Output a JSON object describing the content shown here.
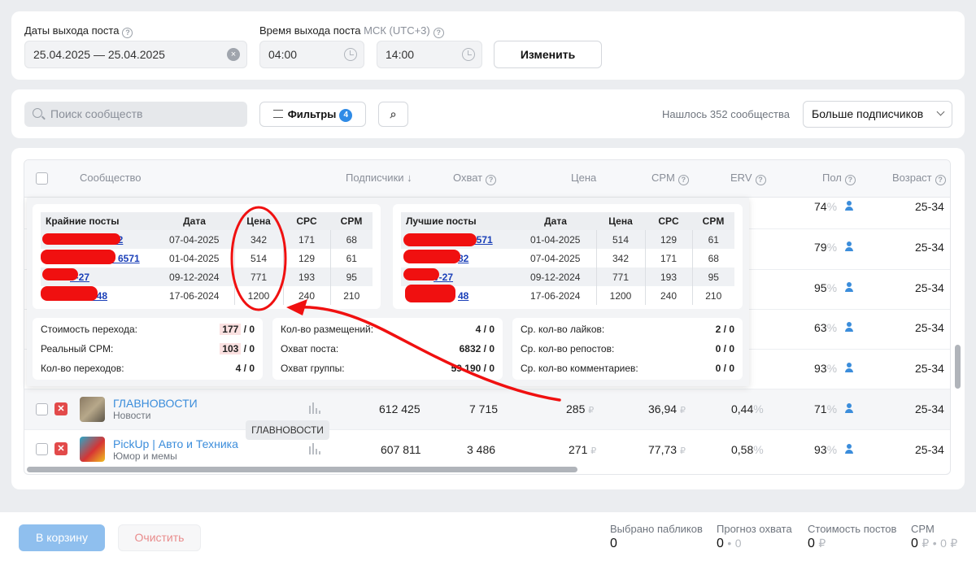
{
  "dates": {
    "label": "Даты выхода поста",
    "value": "25.04.2025 — 25.04.2025",
    "clear_icon": "clear-icon"
  },
  "time": {
    "label": "Время выхода поста",
    "tz": "МСК (UTC+3)",
    "from": "04:00",
    "to": "14:00",
    "apply_label": "Изменить"
  },
  "toolbar": {
    "search_placeholder": "Поиск сообществ",
    "filters_label": "Фильтры",
    "filters_count": "4",
    "found_text": "Нашлось 352 сообщества",
    "sort_value": "Больше подписчиков"
  },
  "table": {
    "headers": [
      "Сообщество",
      "Подписчики",
      "Охват",
      "Цена",
      "CPM",
      "ERV",
      "Пол",
      "Возраст"
    ],
    "sort_arrow": "↓",
    "bg_rows": [
      {
        "gender": "74",
        "age": "25-34"
      },
      {
        "gender": "79",
        "age": "25-34"
      },
      {
        "gender": "95",
        "age": "25-34"
      },
      {
        "gender": "63",
        "age": "25-34"
      },
      {
        "gender": "93",
        "age": "25-34"
      }
    ],
    "rows": [
      {
        "name": "ГЛАВНОВОСТИ",
        "category": "Новости",
        "subscribers": "612 425",
        "reach": "7 715",
        "price": "285",
        "cpm": "36,94",
        "erv": "0,44",
        "gender": "71",
        "age": "25-34"
      },
      {
        "name": "PickUp | Авто и Техника",
        "category": "Юмор и мемы",
        "subscribers": "607 811",
        "reach": "3 486",
        "price": "271",
        "cpm": "77,73",
        "erv": "0,58",
        "gender": "93",
        "age": "25-34"
      }
    ],
    "tooltip": "ГЛАВНОВОСТИ",
    "pct_sign": "%",
    "rub_sign": "₽"
  },
  "popup": {
    "recent": {
      "headers": [
        "Крайние посты",
        "Дата",
        "Цена",
        "CPC",
        "CPM"
      ],
      "rows": [
        {
          "link": "82",
          "date": "07-04-2025",
          "price": "342",
          "cpc": "171",
          "cpm": "68"
        },
        {
          "link": "b_6571",
          "date": "01-04-2025",
          "price": "514",
          "cpc": "129",
          "cpm": "61"
        },
        {
          "link": "v-27",
          "date": "09-12-2024",
          "price": "771",
          "cpc": "193",
          "cpm": "95"
        },
        {
          "link": "548",
          "date": "17-06-2024",
          "price": "1200",
          "cpc": "240",
          "cpm": "210"
        }
      ]
    },
    "best": {
      "headers": [
        "Лучшие посты",
        "Дата",
        "Цена",
        "CPC",
        "CPM"
      ],
      "rows": [
        {
          "link": "6571",
          "date": "01-04-2025",
          "price": "514",
          "cpc": "129",
          "cpm": "61"
        },
        {
          "link": "82",
          "date": "07-04-2025",
          "price": "342",
          "cpc": "171",
          "cpm": "68"
        },
        {
          "link": "v-27",
          "date": "09-12-2024",
          "price": "771",
          "cpc": "193",
          "cpm": "95"
        },
        {
          "link": "48",
          "date": "17-06-2024",
          "price": "1200",
          "cpc": "240",
          "cpm": "210"
        }
      ]
    },
    "stats1": [
      {
        "label": "Стоимость перехода:",
        "a": "177",
        "b": " / 0"
      },
      {
        "label": "Реальный CPM:",
        "a": "103",
        "b": " / 0"
      },
      {
        "label": "Кол-во переходов:",
        "a": "4",
        "b": " / 0"
      }
    ],
    "stats2": [
      {
        "label": "Кол-во размещений:",
        "v": "4 / 0"
      },
      {
        "label": "Охват поста:",
        "v": "6832 / 0"
      },
      {
        "label": "Охват группы:",
        "v": "59 190 / 0"
      }
    ],
    "stats3": [
      {
        "label": "Ср. кол-во лайков:",
        "v": "2 / 0"
      },
      {
        "label": "Ср. кол-во репостов:",
        "v": "0 / 0"
      },
      {
        "label": "Ср. кол-во комментариев:",
        "v": "0 / 0"
      }
    ]
  },
  "footer": {
    "cart_label": "В корзину",
    "clear_label": "Очистить",
    "selected_label": "Выбрано пабликов",
    "selected_value": "0",
    "reach_label": "Прогноз охвата",
    "reach_value": "0",
    "cost_label": "Стоимость постов",
    "cost_value": "0",
    "cpm_label": "CPM",
    "cpm_value": "0",
    "sep": "•",
    "zero": "0"
  },
  "colors": {
    "accent": "#2f8be6",
    "link": "#3b8ddb",
    "annotation": "#f01010"
  }
}
